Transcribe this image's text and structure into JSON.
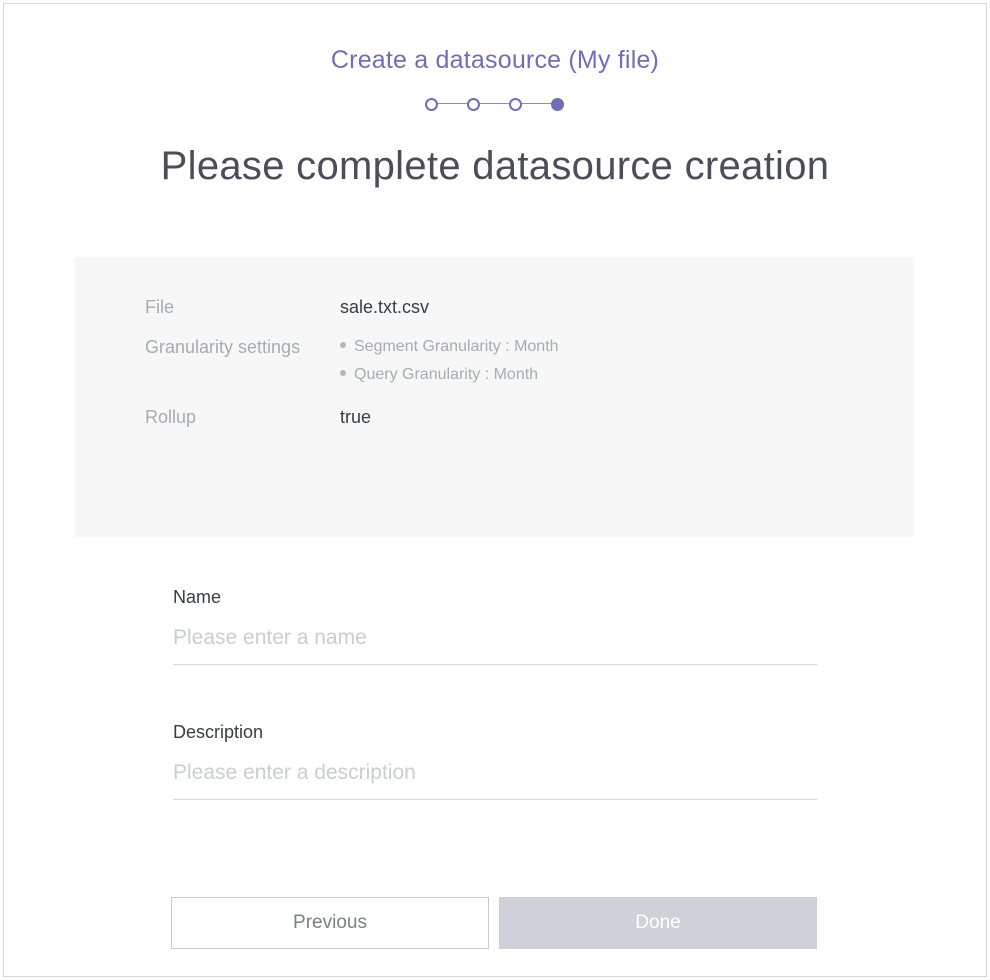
{
  "header": {
    "title": "Create a datasource (My file)"
  },
  "stepper": {
    "steps": 4,
    "current": 4
  },
  "main": {
    "title": "Please complete datasource creation"
  },
  "summary": {
    "file": {
      "label": "File",
      "value": "sale.txt.csv"
    },
    "granularity": {
      "label": "Granularity settings",
      "items": [
        "Segment Granularity : Month",
        "Query Granularity : Month"
      ]
    },
    "rollup": {
      "label": "Rollup",
      "value": "true"
    }
  },
  "form": {
    "name": {
      "label": "Name",
      "placeholder": "Please enter a name",
      "value": ""
    },
    "description": {
      "label": "Description",
      "placeholder": "Please enter a description",
      "value": ""
    }
  },
  "buttons": {
    "previous": "Previous",
    "done": "Done"
  },
  "colors": {
    "accent": "#6e6fb4",
    "done_disabled": "#d0d1d8",
    "summary_bg": "#f7f7f8"
  }
}
